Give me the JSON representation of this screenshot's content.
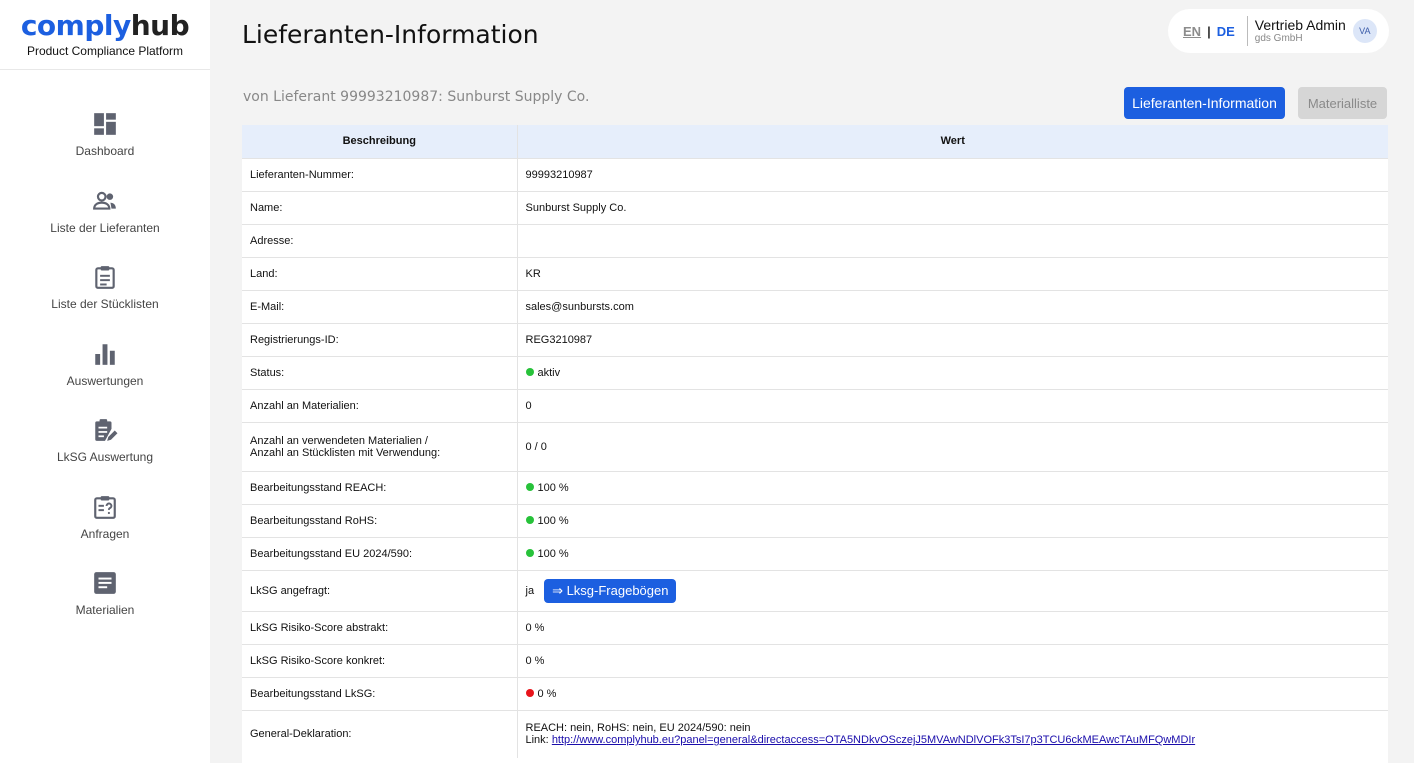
{
  "brand": {
    "part1": "comply",
    "part2": "hub",
    "subtitle": "Product Compliance Platform"
  },
  "nav": [
    {
      "label": "Dashboard",
      "icon": "dashboard-icon"
    },
    {
      "label": "Liste der Lieferanten",
      "icon": "users-icon"
    },
    {
      "label": "Liste der Stücklisten",
      "icon": "clipboard-icon"
    },
    {
      "label": "Auswertungen",
      "icon": "bar-chart-icon"
    },
    {
      "label": "LkSG Auswertung",
      "icon": "clipboard-edit-icon"
    },
    {
      "label": "Anfragen",
      "icon": "clipboard-question-icon"
    },
    {
      "label": "Materialien",
      "icon": "document-icon"
    }
  ],
  "header": {
    "title": "Lieferanten-Information",
    "lang_en": "EN",
    "lang_sep": "|",
    "lang_de": "DE",
    "user_name": "Vertrieb Admin",
    "user_company": "gds GmbH",
    "avatar_initials": "VA"
  },
  "subheader": {
    "subtitle": "von Lieferant 99993210987: Sunburst Supply Co.",
    "btn_info": "Lieferanten-Information",
    "btn_materials": "Materialliste"
  },
  "table": {
    "col_desc": "Beschreibung",
    "col_value": "Wert",
    "rows": {
      "number": {
        "label": "Lieferanten-Nummer:",
        "value": "99993210987"
      },
      "name": {
        "label": "Name:",
        "value": "Sunburst Supply Co."
      },
      "address": {
        "label": "Adresse:",
        "value": ""
      },
      "country": {
        "label": "Land:",
        "value": "KR"
      },
      "email": {
        "label": "E-Mail:",
        "value": "sales@sunbursts.com"
      },
      "reg_id": {
        "label": "Registrierungs-ID:",
        "value": "REG3210987"
      },
      "status": {
        "label": "Status:",
        "value": "aktiv"
      },
      "materials_count": {
        "label": "Anzahl an Materialien:",
        "value": "0"
      },
      "used_materials": {
        "label_line1": "Anzahl an verwendeten Materialien /",
        "label_line2": "Anzahl an Stücklisten mit Verwendung:",
        "value": "0 / 0"
      },
      "reach": {
        "label": "Bearbeitungsstand REACH:",
        "value": "100 %"
      },
      "rohs": {
        "label": "Bearbeitungsstand RoHS:",
        "value": "100 %"
      },
      "eu": {
        "label": "Bearbeitungsstand EU 2024/590:",
        "value": "100 %"
      },
      "lksg_requested": {
        "label": "LkSG angefragt:",
        "value": "ja",
        "button": "⇒ Lksg-Fragebögen"
      },
      "lksg_abstract": {
        "label": "LkSG Risiko-Score abstrakt:",
        "value": "0 %"
      },
      "lksg_concrete": {
        "label": "LkSG Risiko-Score konkret:",
        "value": "0 %"
      },
      "lksg_progress": {
        "label": "Bearbeitungsstand LkSG:",
        "value": "0 %"
      },
      "declaration": {
        "label": "General-Deklaration:",
        "value": "REACH: nein, RoHS: nein, EU 2024/590: nein",
        "link_prefix": "Link:",
        "link": "http://www.complyhub.eu?panel=general&directaccess=OTA5NDkvOSczejJ5MVAwNDlVOFk3TsI7p3TCU6ckMEAwcTAuMFQwMDIr"
      }
    }
  },
  "colors": {
    "accent": "#1c5fe0",
    "ok": "#27c23a",
    "error": "#e8141b"
  }
}
